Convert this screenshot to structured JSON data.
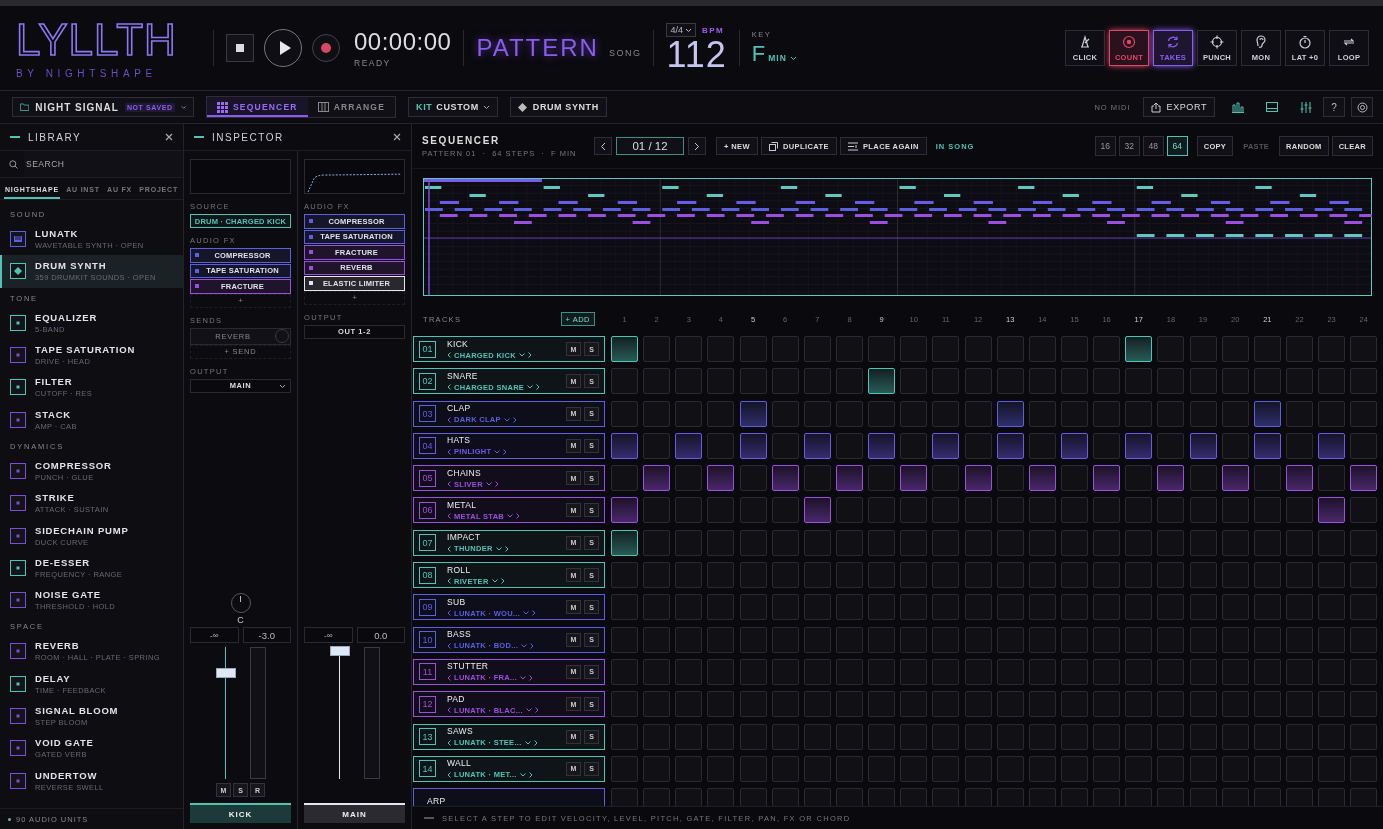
{
  "app": {
    "logo": "LYLLTH",
    "byline": "BY NIGHTSHAPE"
  },
  "transport": {
    "time": "00:00:00",
    "status": "READY"
  },
  "modes": [
    {
      "label": "PATTERN",
      "selected": true
    },
    {
      "label": "SONG",
      "selected": false
    }
  ],
  "tempo": {
    "meter": "4/4",
    "unit": "BPM",
    "bpm": "112"
  },
  "key": {
    "label": "KEY",
    "note": "F",
    "scale": "MIN"
  },
  "toggles": [
    {
      "kind": "click",
      "label": "CLICK",
      "on": false
    },
    {
      "kind": "count",
      "label": "COUNT",
      "on": true,
      "color": "#e0456a"
    },
    {
      "kind": "takes",
      "label": "TAKES",
      "on": true,
      "color": "#8a5cf0"
    },
    {
      "kind": "punch",
      "label": "PUNCH",
      "on": false
    },
    {
      "kind": "monitor",
      "label": "MON",
      "on": false
    },
    {
      "kind": "latency",
      "label": "LAT +0",
      "on": false
    },
    {
      "kind": "loop",
      "label": "LOOP",
      "on": false
    }
  ],
  "toolbar": {
    "project": "NIGHT SIGNAL",
    "save_state": "NOT SAVED",
    "views": [
      {
        "kind": "grid",
        "label": "SEQUENCER",
        "selected": true
      },
      {
        "kind": "columns",
        "label": "ARRANGE",
        "selected": false
      }
    ],
    "kit_label": "KIT",
    "kit": "CUSTOM",
    "instrument": "DRUM SYNTH",
    "midi": "NO MIDI",
    "export": "EXPORT",
    "help": "?"
  },
  "library": {
    "title": "LIBRARY",
    "search": {
      "placeholder": "SEARCH"
    },
    "tabs": [
      {
        "label": "NIGHTSHAPE",
        "selected": true
      },
      {
        "label": "AU INST",
        "selected": false
      },
      {
        "label": "AU FX",
        "selected": false
      },
      {
        "label": "PROJECT",
        "selected": false
      }
    ],
    "sections": [
      {
        "title": "SOUND",
        "items": [
          {
            "kind": "synth",
            "name": "LUNATK",
            "sub": "WAVETABLE SYNTH · OPEN",
            "color": "#5b5fe0",
            "selected": false
          },
          {
            "kind": "drum",
            "name": "DRUM SYNTH",
            "sub": "359 DRUMKIT SOUNDS · OPEN",
            "color": "#4fc4b4",
            "selected": true
          }
        ]
      },
      {
        "title": "TONE",
        "items": [
          {
            "kind": "effect",
            "name": "EQUALIZER",
            "sub": "5-BAND",
            "color": "#4fc4b4",
            "selected": false
          },
          {
            "kind": "effect",
            "name": "TAPE SATURATION",
            "sub": "DRIVE · HEAD",
            "color": "#7a4fd8",
            "selected": false
          },
          {
            "kind": "effect",
            "name": "FILTER",
            "sub": "CUTOFF · RES",
            "color": "#4fc4b4",
            "selected": false
          },
          {
            "kind": "effect",
            "name": "STACK",
            "sub": "AMP · CAB",
            "color": "#7a4fd8",
            "selected": false
          }
        ]
      },
      {
        "title": "DYNAMICS",
        "items": [
          {
            "kind": "effect",
            "name": "COMPRESSOR",
            "sub": "PUNCH · GLUE",
            "color": "#7a4fd8",
            "selected": false
          },
          {
            "kind": "effect",
            "name": "STRIKE",
            "sub": "ATTACK · SUSTAIN",
            "color": "#7a4fd8",
            "selected": false
          },
          {
            "kind": "effect",
            "name": "SIDECHAIN PUMP",
            "sub": "DUCK CURVE",
            "color": "#7a4fd8",
            "selected": false
          },
          {
            "kind": "effect",
            "name": "DE-ESSER",
            "sub": "FREQUENCY · RANGE",
            "color": "#4fc4b4",
            "selected": false
          },
          {
            "kind": "effect",
            "name": "NOISE GATE",
            "sub": "THRESHOLD · HOLD",
            "color": "#7a4fd8",
            "selected": false
          }
        ]
      },
      {
        "title": "SPACE",
        "items": [
          {
            "kind": "effect",
            "name": "REVERB",
            "sub": "ROOM · HALL · PLATE · SPRING",
            "color": "#7a4fd8",
            "selected": false
          },
          {
            "kind": "effect",
            "name": "DELAY",
            "sub": "TIME · FEEDBACK",
            "color": "#4fc4b4",
            "selected": false
          },
          {
            "kind": "effect",
            "name": "SIGNAL BLOOM",
            "sub": "STEP BLOOM",
            "color": "#7a4fd8",
            "selected": false
          },
          {
            "kind": "effect",
            "name": "VOID GATE",
            "sub": "GATED VERB",
            "color": "#7a4fd8",
            "selected": false
          },
          {
            "kind": "effect",
            "name": "UNDERTOW",
            "sub": "REVERSE SWELL",
            "color": "#7a4fd8",
            "selected": false
          }
        ]
      }
    ],
    "footer": "90 AUDIO UNITS"
  },
  "inspector": {
    "title": "INSPECTOR",
    "strips": [
      {
        "kind": "track",
        "source_label": "SOURCE",
        "source": "DRUM · CHARGED KICK",
        "fx_label": "AUDIO FX",
        "fx": [
          {
            "name": "COMPRESSOR",
            "color": "#5b5fe0"
          },
          {
            "name": "TAPE SATURATION",
            "color": "#5b5fe0"
          },
          {
            "name": "FRACTURE",
            "color": "#9a4fe0"
          }
        ],
        "add_fx": "+",
        "sends_label": "SENDS",
        "sends": [
          {
            "name": "REVERB"
          }
        ],
        "add_send": "+ SEND",
        "output_label": "OUTPUT",
        "output": "MAIN",
        "pan": "C",
        "min": "-∞",
        "gain": "-3.0",
        "level": 0.8,
        "buttons": [
          "M",
          "S",
          "R"
        ],
        "name": "KICK",
        "color": "#4fc4b4"
      },
      {
        "kind": "master",
        "fx_label": "AUDIO FX",
        "fx": [
          {
            "name": "COMPRESSOR",
            "color": "#5b5fe0"
          },
          {
            "name": "TAPE SATURATION",
            "color": "#5b5fe0"
          },
          {
            "name": "FRACTURE",
            "color": "#9a4fe0"
          },
          {
            "name": "REVERB",
            "color": "#9a4fe0"
          },
          {
            "name": "ELASTIC LIMITER",
            "color": "#e6e6ee"
          }
        ],
        "add_fx": "+",
        "output_label": "OUTPUT",
        "output": "OUT 1-2",
        "min": "-∞",
        "gain": "0.0",
        "level": 0.97,
        "name": "MAIN",
        "color": "#e6e6ee"
      }
    ]
  },
  "sequencer": {
    "title": "SEQUENCER",
    "info": "PATTERN 01  ·  64 STEPS  ·  F MIN",
    "page": "01 / 12",
    "actions": [
      {
        "kind": "new",
        "label": "+ NEW"
      },
      {
        "kind": "duplicate",
        "label": "DUPLICATE"
      },
      {
        "kind": "place",
        "label": "PLACE AGAIN"
      }
    ],
    "in_song": "IN SONG",
    "lengths": [
      {
        "label": "16",
        "selected": false
      },
      {
        "label": "32",
        "selected": false
      },
      {
        "label": "48",
        "selected": false
      },
      {
        "label": "64",
        "selected": true
      }
    ],
    "edits": [
      {
        "label": "COPY",
        "disabled": false
      },
      {
        "label": "PASTE",
        "disabled": true
      },
      {
        "label": "RANDOM",
        "disabled": false
      },
      {
        "label": "CLEAR",
        "disabled": false
      }
    ],
    "tracks_label": "TRACKS",
    "add": "+ ADD",
    "step_numbers": [
      "1",
      "2",
      "3",
      "4",
      "5",
      "6",
      "7",
      "8",
      "9",
      "10",
      "11",
      "12",
      "13",
      "14",
      "15",
      "16",
      "17",
      "18",
      "19",
      "20",
      "21",
      "22",
      "23",
      "24"
    ],
    "tracks": [
      {
        "number": "01",
        "name": "KICK",
        "sub": "CHARGED KICK",
        "color": "#4fc4b4",
        "mute": "M",
        "solo": "S",
        "steps": [
          true,
          false,
          false,
          false,
          false,
          false,
          false,
          false,
          false,
          false,
          false,
          false,
          false,
          false,
          false,
          false,
          true,
          false,
          false,
          false,
          false,
          false,
          false,
          false
        ]
      },
      {
        "number": "02",
        "name": "SNARE",
        "sub": "CHARGED SNARE",
        "color": "#4fc4b4",
        "mute": "M",
        "solo": "S",
        "steps": [
          false,
          false,
          false,
          false,
          false,
          false,
          false,
          false,
          true,
          false,
          false,
          false,
          false,
          false,
          false,
          false,
          false,
          false,
          false,
          false,
          false,
          false,
          false,
          false
        ]
      },
      {
        "number": "03",
        "name": "CLAP",
        "sub": "DARK CLAP",
        "color": "#5b5fe0",
        "mute": "M",
        "solo": "S",
        "steps": [
          false,
          false,
          false,
          false,
          true,
          false,
          false,
          false,
          false,
          false,
          false,
          false,
          true,
          false,
          false,
          false,
          false,
          false,
          false,
          false,
          true,
          false,
          false,
          false
        ]
      },
      {
        "number": "04",
        "name": "HATS",
        "sub": "PINLIGHT",
        "color": "#6a5ae8",
        "mute": "M",
        "solo": "S",
        "steps": [
          true,
          false,
          true,
          false,
          true,
          false,
          true,
          false,
          true,
          false,
          true,
          false,
          true,
          false,
          true,
          false,
          true,
          false,
          true,
          false,
          true,
          false,
          true,
          false
        ]
      },
      {
        "number": "05",
        "name": "CHAINS",
        "sub": "SLIVER",
        "color": "#9a4fe0",
        "mute": "M",
        "solo": "S",
        "steps": [
          false,
          true,
          false,
          true,
          false,
          true,
          false,
          true,
          false,
          true,
          false,
          true,
          false,
          true,
          false,
          true,
          false,
          true,
          false,
          true,
          false,
          true,
          false,
          true
        ]
      },
      {
        "number": "06",
        "name": "METAL",
        "sub": "METAL STAB",
        "color": "#9a4fe0",
        "mute": "M",
        "solo": "S",
        "steps": [
          true,
          false,
          false,
          false,
          false,
          false,
          true,
          false,
          false,
          false,
          false,
          false,
          false,
          false,
          false,
          false,
          false,
          false,
          false,
          false,
          false,
          false,
          true,
          false
        ]
      },
      {
        "number": "07",
        "name": "IMPACT",
        "sub": "THUNDER",
        "color": "#4fc4b4",
        "mute": "M",
        "solo": "S",
        "steps": [
          true,
          false,
          false,
          false,
          false,
          false,
          false,
          false,
          false,
          false,
          false,
          false,
          false,
          false,
          false,
          false,
          false,
          false,
          false,
          false,
          false,
          false,
          false,
          false
        ]
      },
      {
        "number": "08",
        "name": "ROLL",
        "sub": "RIVETER",
        "color": "#4fc4b4",
        "mute": "M",
        "solo": "S",
        "steps": [
          false,
          false,
          false,
          false,
          false,
          false,
          false,
          false,
          false,
          false,
          false,
          false,
          false,
          false,
          false,
          false,
          false,
          false,
          false,
          false,
          false,
          false,
          false,
          false
        ]
      },
      {
        "number": "09",
        "name": "SUB",
        "sub": "LUNATK · WOU...",
        "color": "#5b5fe0",
        "mute": "M",
        "solo": "S",
        "steps": [
          false,
          false,
          false,
          false,
          false,
          false,
          false,
          false,
          false,
          false,
          false,
          false,
          false,
          false,
          false,
          false,
          false,
          false,
          false,
          false,
          false,
          false,
          false,
          false
        ]
      },
      {
        "number": "10",
        "name": "BASS",
        "sub": "LUNATK · BOD...",
        "color": "#5b5fe0",
        "mute": "M",
        "solo": "S",
        "steps": [
          false,
          false,
          false,
          false,
          false,
          false,
          false,
          false,
          false,
          false,
          false,
          false,
          false,
          false,
          false,
          false,
          false,
          false,
          false,
          false,
          false,
          false,
          false,
          false
        ]
      },
      {
        "number": "11",
        "name": "STUTTER",
        "sub": "LUNATK · FRA...",
        "color": "#9a4fe0",
        "mute": "M",
        "solo": "S",
        "steps": [
          false,
          false,
          false,
          false,
          false,
          false,
          false,
          false,
          false,
          false,
          false,
          false,
          false,
          false,
          false,
          false,
          false,
          false,
          false,
          false,
          false,
          false,
          false,
          false
        ]
      },
      {
        "number": "12",
        "name": "PAD",
        "sub": "LUNATK · BLAC...",
        "color": "#9a4fe0",
        "mute": "M",
        "solo": "S",
        "steps": [
          false,
          false,
          false,
          false,
          false,
          false,
          false,
          false,
          false,
          false,
          false,
          false,
          false,
          false,
          false,
          false,
          false,
          false,
          false,
          false,
          false,
          false,
          false,
          false
        ]
      },
      {
        "number": "13",
        "name": "SAWS",
        "sub": "LUNATK · STEE...",
        "color": "#4fc4b4",
        "mute": "M",
        "solo": "S",
        "steps": [
          false,
          false,
          false,
          false,
          false,
          false,
          false,
          false,
          false,
          false,
          false,
          false,
          false,
          false,
          false,
          false,
          false,
          false,
          false,
          false,
          false,
          false,
          false,
          false
        ]
      },
      {
        "number": "14",
        "name": "WALL",
        "sub": "LUNATK · MET...",
        "color": "#4fc4b4",
        "mute": "M",
        "solo": "S",
        "steps": [
          false,
          false,
          false,
          false,
          false,
          false,
          false,
          false,
          false,
          false,
          false,
          false,
          false,
          false,
          false,
          false,
          false,
          false,
          false,
          false,
          false,
          false,
          false,
          false
        ]
      },
      {
        "name": "ARP",
        "color": "#5b5fe0",
        "steps": [
          false,
          false,
          false,
          false,
          false,
          false,
          false,
          false,
          false,
          false,
          false,
          false,
          false,
          false,
          false,
          false,
          false,
          false,
          false,
          false,
          false,
          false,
          false,
          false
        ]
      }
    ],
    "hint": "SELECT A STEP TO EDIT VELOCITY, LEVEL, PITCH, GATE, FILTER, PAN, FX OR CHORD"
  }
}
